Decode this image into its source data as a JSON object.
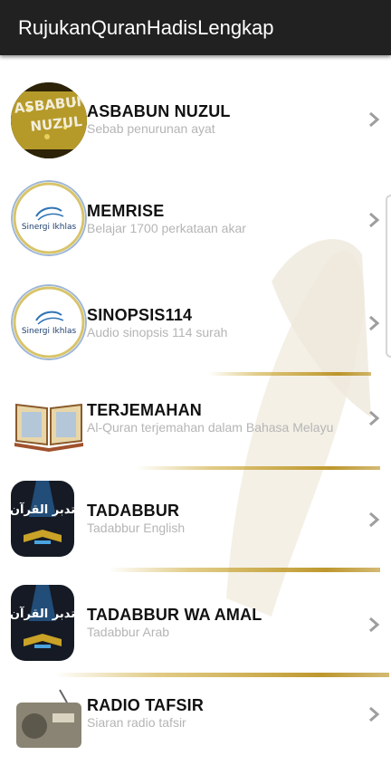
{
  "app": {
    "title": "RujukanQuranHadisLengkap"
  },
  "items": [
    {
      "title": "ASBABUN NUZUL",
      "subtitle": "Sebab penurunan ayat",
      "icon": "asbabun-nuzul-logo-icon",
      "logo_text": "ASBABUN NUZUL"
    },
    {
      "title": "MEMRISE",
      "subtitle": "Belajar 1700 perkataan akar",
      "icon": "sinergi-ikhlas-logo-icon",
      "logo_text": "Sinergi Ikhlas"
    },
    {
      "title": "SINOPSIS114",
      "subtitle": "Audio sinopsis 114 surah",
      "icon": "sinergi-ikhlas-logo-icon",
      "logo_text": "Sinergi Ikhlas"
    },
    {
      "title": "TERJEMAHAN",
      "subtitle": "Al-Quran terjemahan dalam Bahasa Melayu",
      "icon": "open-quran-book-icon"
    },
    {
      "title": "TADABBUR",
      "subtitle": "Tadabbur English",
      "icon": "tadabbur-quran-icon",
      "logo_text": "تدبر القرآن"
    },
    {
      "title": "TADABBUR WA AMAL",
      "subtitle": "Tadabbur Arab",
      "icon": "tadabbur-quran-icon",
      "logo_text": "تدبر القرآن"
    },
    {
      "title": "RADIO TAFSIR",
      "subtitle": "Siaran radio tafsir",
      "icon": "radio-icon"
    }
  ],
  "colors": {
    "appbar": "#212121",
    "gold": "#c9a227",
    "subtitle": "#b5b5b5",
    "chevron": "#9e9e9e"
  }
}
